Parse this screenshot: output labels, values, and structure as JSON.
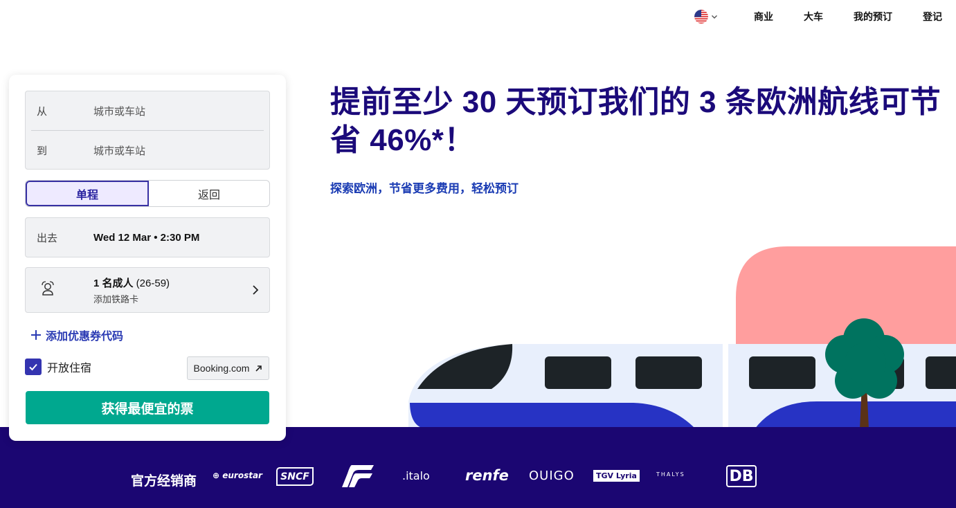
{
  "nav": {
    "language_icon": "us-flag-icon",
    "items": [
      "商业",
      "大车",
      "我的预订",
      "登记"
    ]
  },
  "hero": {
    "title": "提前至少 30 天预订我们的 3 条欧洲航线可节省 46%*！",
    "subtitle": "探索欧洲，节省更多费用，轻松预订"
  },
  "search": {
    "from_label": "从",
    "from_placeholder": "城市或车站",
    "to_label": "到",
    "to_placeholder": "城市或车站",
    "trip_options": [
      "单程",
      "返回"
    ],
    "trip_selected": "单程",
    "depart_label": "出去",
    "depart_value": "Wed 12 Mar • 2:30 PM",
    "passengers_count": "1 名成人",
    "passengers_age": " (26-59)",
    "railcard_label": "添加铁路卡",
    "promo_label": "添加优惠券代码",
    "accommodation_label": "开放住宿",
    "accommodation_checked": true,
    "booking_label": "Booking.com",
    "submit_label": "获得最便宜的票"
  },
  "partners": {
    "label": "官方经销商",
    "logos": [
      "eurostar",
      "SNCF",
      "trenitalia-icon",
      ".italo",
      "renfe",
      "OUIGO",
      "TGV Lyria",
      "THALYS",
      "DB"
    ]
  },
  "colors": {
    "brand_dark": "#1b0672",
    "title": "#1b0a7a",
    "accent": "#3434b0",
    "cta": "#00a88f",
    "illustration_pink": "#ff9e9e",
    "train_blue": "#2733c4"
  }
}
